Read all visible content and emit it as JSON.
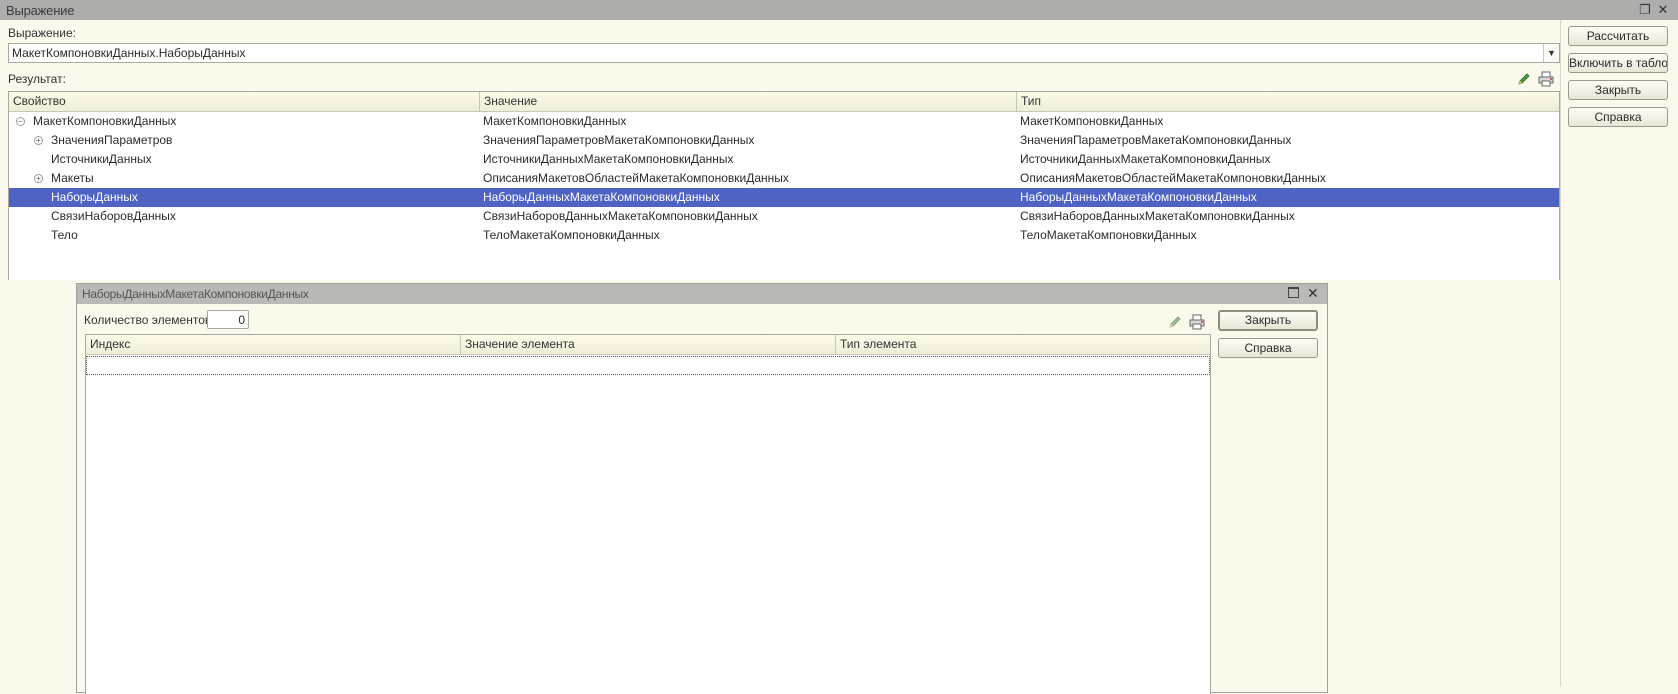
{
  "window": {
    "title": "Выражение"
  },
  "expression": {
    "label": "Выражение:",
    "value": "МакетКомпоновкиДанных.НаборыДанных"
  },
  "result": {
    "label": "Результат:",
    "columns": [
      "Свойство",
      "Значение",
      "Тип"
    ],
    "rows": [
      {
        "property": "МакетКомпоновкиДанных",
        "value": "МакетКомпоновкиДанных",
        "type": "МакетКомпоновкиДанных",
        "node": "collapse",
        "level": 0
      },
      {
        "property": "ЗначенияПараметров",
        "value": "ЗначенияПараметровМакетаКомпоновкиДанных",
        "type": "ЗначенияПараметровМакетаКомпоновкиДанных",
        "node": "expand",
        "level": 1
      },
      {
        "property": "ИсточникиДанных",
        "value": "ИсточникиДанныхМакетаКомпоновкиДанных",
        "type": "ИсточникиДанныхМакетаКомпоновкиДанных",
        "node": "none",
        "level": 1
      },
      {
        "property": "Макеты",
        "value": "ОписанияМакетовОбластейМакетаКомпоновкиДанных",
        "type": "ОписанияМакетовОбластейМакетаКомпоновкиДанных",
        "node": "expand",
        "level": 1
      },
      {
        "property": "НаборыДанных",
        "value": "НаборыДанныхМакетаКомпоновкиДанных",
        "type": "НаборыДанныхМакетаКомпоновкиДанных",
        "node": "none",
        "level": 1,
        "selected": true
      },
      {
        "property": "СвязиНаборовДанных",
        "value": "СвязиНаборовДанныхМакетаКомпоновкиДанных",
        "type": "СвязиНаборовДанныхМакетаКомпоновкиДанных",
        "node": "none",
        "level": 1
      },
      {
        "property": "Тело",
        "value": "ТелоМакетаКомпоновкиДанных",
        "type": "ТелоМакетаКомпоновкиДанных",
        "node": "none",
        "level": 1
      }
    ]
  },
  "buttons": {
    "calculate": "Рассчитать",
    "add_to_board": "Включить в табло",
    "close": "Закрыть",
    "help": "Справка"
  },
  "subwindow": {
    "title": "НаборыДанныхМакетаКомпоновкиДанных",
    "count_label": "Количество элементов:",
    "count_value": "0",
    "columns": [
      "Индекс",
      "Значение элемента",
      "Тип элемента"
    ],
    "close_label": "Закрыть",
    "help_label": "Справка"
  },
  "icons": {
    "restore": "restore-icon",
    "close": "close-icon",
    "edit": "pencil-icon",
    "print": "printer-icon",
    "expand": "plus-circle-icon",
    "collapse": "minus-circle-icon"
  },
  "colors": {
    "background": "#FBF9EC",
    "titlebar": "#ADADAB",
    "selection": "#4E63C2"
  }
}
